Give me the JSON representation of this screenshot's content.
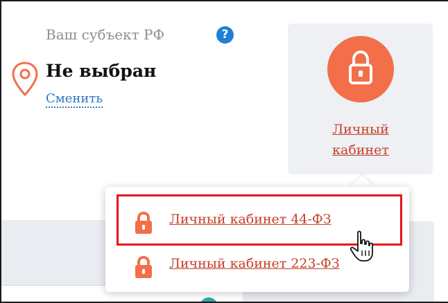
{
  "region": {
    "label": "Ваш субъект РФ",
    "value": "Не выбран",
    "change_link": "Сменить",
    "help_icon": "question-circle-icon",
    "pin_icon": "map-pin-icon"
  },
  "cabinet": {
    "label_line1": "Личный",
    "label_line2": "кабинет",
    "icon": "lock-icon"
  },
  "dropdown": {
    "items": [
      {
        "label": "Личный кабинет 44-ФЗ",
        "icon": "lock-icon",
        "highlighted": true
      },
      {
        "label": "Личный кабинет 223-ФЗ",
        "icon": "lock-icon",
        "highlighted": false
      }
    ]
  },
  "colors": {
    "accent_orange": "#f26f4a",
    "link_red": "#c4402a",
    "link_blue": "#2b78c2",
    "help_blue": "#1f7fd6",
    "highlight_red": "#e8121c"
  }
}
